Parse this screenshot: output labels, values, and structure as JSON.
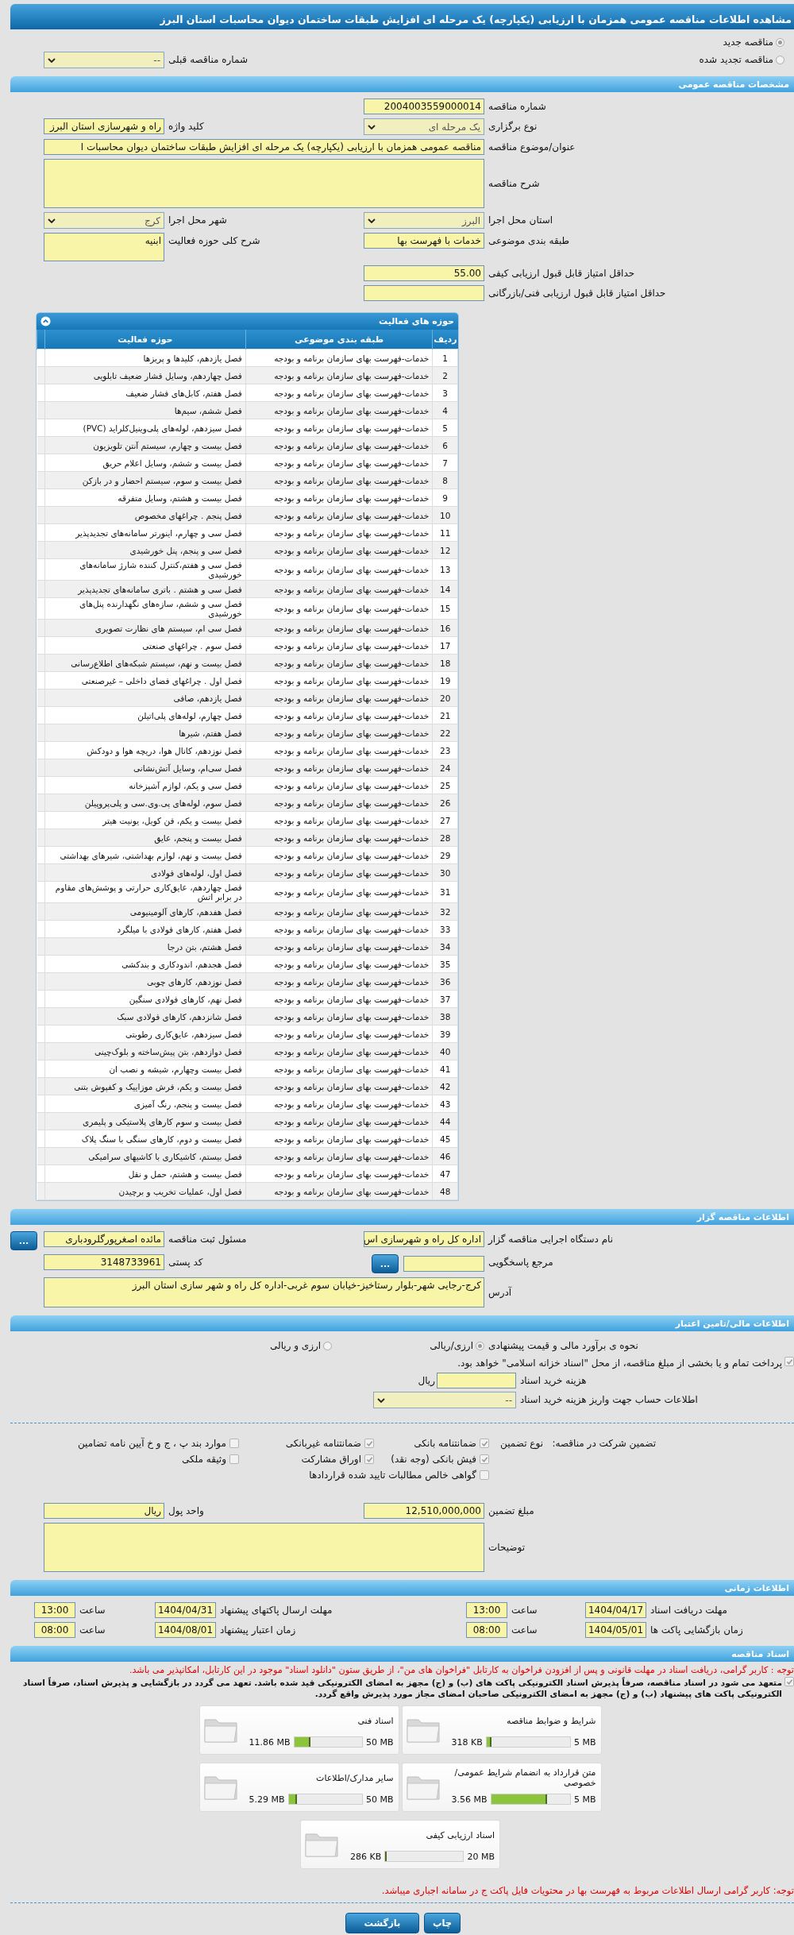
{
  "title": "مشاهده اطلاعات مناقصه عمومی همزمان با ارزیابی (یکپارچه) یک مرحله ای افزایش طبقات ساختمان دیوان محاسبات استان البرز",
  "tender_status": [
    {
      "label": "مناقصه جدید",
      "selected": true
    },
    {
      "label": "مناقصه تجدید شده",
      "selected": false
    }
  ],
  "previous_tender": {
    "label": "شماره مناقصه قبلی",
    "value": "--"
  },
  "general": {
    "header": "مشخصات مناقصه عمومی",
    "rows": [
      [
        {
          "kind": "text",
          "label": "شماره مناقصه",
          "value": "2004003559000014"
        }
      ],
      [
        {
          "kind": "select",
          "label": "نوع برگزاری",
          "value": "یک مرحله ای"
        },
        {
          "kind": "text",
          "label": "کلید واژه",
          "value": "راه و شهرسازی استان البرز"
        }
      ],
      [
        {
          "kind": "title",
          "label": "عنوان/موضوع مناقصه",
          "value": "مناقصه عمومی همزمان با ارزیابی (یکپارچه) یک مرحله ای افزایش طبقات ساختمان دیوان محاسبات ا"
        }
      ],
      [
        {
          "kind": "memo",
          "label": "شرح مناقصه"
        }
      ],
      [
        {
          "kind": "select",
          "label": "استان محل اجرا",
          "value": "البرز"
        },
        {
          "kind": "select",
          "label": "شهر محل اجرا",
          "value": "کرج"
        }
      ],
      [
        {
          "kind": "text",
          "label": "طبقه بندی موضوعی",
          "value": "خدمات با فهرست بها"
        },
        {
          "kind": "area",
          "label": "شرح کلی حوزه فعالیت",
          "value": "ابنیه"
        }
      ],
      [
        {
          "kind": "text",
          "label": "حداقل امتیاز قابل قبول ارزیابی کیفی",
          "value": "55.00"
        }
      ],
      [
        {
          "kind": "text",
          "label": "حداقل امتیاز قابل قبول ارزیابی فنی/بازرگانی"
        }
      ]
    ]
  },
  "activities": {
    "header": "حوزه های فعالیت",
    "columns": [
      "ردیف",
      "طبقه بندی موضوعی",
      "حوزه فعالیت"
    ],
    "rows": [
      {
        "no": "1",
        "category": "خدمات-فهرست بهای سازمان برنامه و بودجه",
        "field": "فصل یازدهم، کلیدها و پریزها"
      },
      {
        "no": "2",
        "category": "خدمات-فهرست بهای سازمان برنامه و بودجه",
        "field": "فصل چهاردهم، وسایل فشار ضعیف تابلویی"
      },
      {
        "no": "3",
        "category": "خدمات-فهرست بهای سازمان برنامه و بودجه",
        "field": "فصل هفتم، کابل‌های فشار ضعیف"
      },
      {
        "no": "4",
        "category": "خدمات-فهرست بهای سازمان برنامه و بودجه",
        "field": "فصل ششم، سیم‌ها"
      },
      {
        "no": "5",
        "category": "خدمات-فهرست بهای سازمان برنامه و بودجه",
        "field": "فصل سیزدهم، لوله‌های پلی‌وینیل‌کلراید (PVC)"
      },
      {
        "no": "6",
        "category": "خدمات-فهرست بهای سازمان برنامه و بودجه",
        "field": "فصل بیست و چهارم، سیستم آنتن تلویزیون"
      },
      {
        "no": "7",
        "category": "خدمات-فهرست بهای سازمان برنامه و بودجه",
        "field": "فصل بیست و ششم، وسایل اعلام حریق"
      },
      {
        "no": "8",
        "category": "خدمات-فهرست بهای سازمان برنامه و بودجه",
        "field": "فصل بیست و سوم، سیستم احضار و در بازکن"
      },
      {
        "no": "9",
        "category": "خدمات-فهرست بهای سازمان برنامه و بودجه",
        "field": "فصل بیست و هشتم، وسایل متفرقه"
      },
      {
        "no": "10",
        "category": "خدمات-فهرست بهای سازمان برنامه و بودجه",
        "field": "فصل پنجم . چراغهای مخصوص"
      },
      {
        "no": "11",
        "category": "خدمات-فهرست بهای سازمان برنامه و بودجه",
        "field": "فصل سی و چهارم، اینورتر سامانه‌های تجدیدپذیر"
      },
      {
        "no": "12",
        "category": "خدمات-فهرست بهای سازمان برنامه و بودجه",
        "field": "فصل سی و پنجم، پنل خورشیدی"
      },
      {
        "no": "13",
        "category": "خدمات-فهرست بهای سازمان برنامه و بودجه",
        "field": "فصل سی و هفتم،کنترل کننده شارژ سامانه‌های خورشیدی"
      },
      {
        "no": "14",
        "category": "خدمات-فهرست بهای سازمان برنامه و بودجه",
        "field": "فصل سی و هشتم . باتری سامانه‌های تجدیدپذیر"
      },
      {
        "no": "15",
        "category": "خدمات-فهرست بهای سازمان برنامه و بودجه",
        "field": "فصل سی و ششم، سازه‌های نگهدارنده پنل‌های خورشیدی"
      },
      {
        "no": "16",
        "category": "خدمات-فهرست بهای سازمان برنامه و بودجه",
        "field": "فصل سی ام، سیستم های نظارت تصویری"
      },
      {
        "no": "17",
        "category": "خدمات-فهرست بهای سازمان برنامه و بودجه",
        "field": "فصل سوم . چراغهای صنعتی"
      },
      {
        "no": "18",
        "category": "خدمات-فهرست بهای سازمان برنامه و بودجه",
        "field": "فصل بیست و نهم، سیستم شبکه‌های اطلاع‌رسانی"
      },
      {
        "no": "19",
        "category": "خدمات-فهرست بهای سازمان برنامه و بودجه",
        "field": "فصل اول . چراغهای فضای داخلی – غیرصنعتی"
      },
      {
        "no": "20",
        "category": "خدمات-فهرست بهای سازمان برنامه و بودجه",
        "field": "فصل یازدهم، صافی"
      },
      {
        "no": "21",
        "category": "خدمات-فهرست بهای سازمان برنامه و بودجه",
        "field": "فصل چهارم، لوله‌های پلی‌اتیلن"
      },
      {
        "no": "22",
        "category": "خدمات-فهرست بهای سازمان برنامه و بودجه",
        "field": "فصل هفتم، شیرها"
      },
      {
        "no": "23",
        "category": "خدمات-فهرست بهای سازمان برنامه و بودجه",
        "field": "فصل نوزدهم، کانال هوا، دریچه هوا و دودکش"
      },
      {
        "no": "24",
        "category": "خدمات-فهرست بهای سازمان برنامه و بودجه",
        "field": "فصل سی‌ام، وسایل آتش‌نشانی"
      },
      {
        "no": "25",
        "category": "خدمات-فهرست بهای سازمان برنامه و بودجه",
        "field": "فصل سی و یکم، لوازم آشپزخانه"
      },
      {
        "no": "26",
        "category": "خدمات-فهرست بهای سازمان برنامه و بودجه",
        "field": "فصل سوم، لوله‌های پی.وی.سی و پلی‌پروپیلن"
      },
      {
        "no": "27",
        "category": "خدمات-فهرست بهای سازمان برنامه و بودجه",
        "field": "فصل بیست و یکم، فن کویل، یونیت هیتر"
      },
      {
        "no": "28",
        "category": "خدمات-فهرست بهای سازمان برنامه و بودجه",
        "field": "فصل بیست و پنجم، عایق"
      },
      {
        "no": "29",
        "category": "خدمات-فهرست بهای سازمان برنامه و بودجه",
        "field": "فصل بیست و نهم، لوازم بهداشتی، شیرهای بهداشتی"
      },
      {
        "no": "30",
        "category": "خدمات-فهرست بهای سازمان برنامه و بودجه",
        "field": "فصل اول، لوله‌های فولادی"
      },
      {
        "no": "31",
        "category": "خدمات-فهرست بهای سازمان برنامه و بودجه",
        "field": "فصل چهاردهم، عایق‌کاری حرارتی و پوشش‌های مقاوم در برابر اتش"
      },
      {
        "no": "32",
        "category": "خدمات-فهرست بهای سازمان برنامه و بودجه",
        "field": "فصل هفدهم، کارهای آلومینیومی"
      },
      {
        "no": "33",
        "category": "خدمات-فهرست بهای سازمان برنامه و بودجه",
        "field": "فصل هفتم، کارهای فولادی با میلگرد"
      },
      {
        "no": "34",
        "category": "خدمات-فهرست بهای سازمان برنامه و بودجه",
        "field": "فصل هشتم، بتن درجا"
      },
      {
        "no": "35",
        "category": "خدمات-فهرست بهای سازمان برنامه و بودجه",
        "field": "فصل هجدهم، اندودکاری و بندکشی"
      },
      {
        "no": "36",
        "category": "خدمات-فهرست بهای سازمان برنامه و بودجه",
        "field": "فصل نوزدهم، کارهای چوبی"
      },
      {
        "no": "37",
        "category": "خدمات-فهرست بهای سازمان برنامه و بودجه",
        "field": "فصل نهم، کارهای فولادی سنگین"
      },
      {
        "no": "38",
        "category": "خدمات-فهرست بهای سازمان برنامه و بودجه",
        "field": "فصل شانزدهم، کارهای فولادی سبک"
      },
      {
        "no": "39",
        "category": "خدمات-فهرست بهای سازمان برنامه و بودجه",
        "field": "فصل سیزدهم، عایق‌کاری رطوبتی"
      },
      {
        "no": "40",
        "category": "خدمات-فهرست بهای سازمان برنامه و بودجه",
        "field": "فصل دوازدهم، بتن پیش‌ساخته و بلوک‌چینی"
      },
      {
        "no": "41",
        "category": "خدمات-فهرست بهای سازمان برنامه و بودجه",
        "field": "فصل بیست وچهارم، شیشه و نصب ان"
      },
      {
        "no": "42",
        "category": "خدمات-فهرست بهای سازمان برنامه و بودجه",
        "field": "فصل بیست و یکم، فرش موزاییک و کفپوش بتنی"
      },
      {
        "no": "43",
        "category": "خدمات-فهرست بهای سازمان برنامه و بودجه",
        "field": "فصل بیست و پنجم، رنگ آمیزی"
      },
      {
        "no": "44",
        "category": "خدمات-فهرست بهای سازمان برنامه و بودجه",
        "field": "فصل بیست و سوم کارهای پلاستیکی و پلیمری"
      },
      {
        "no": "45",
        "category": "خدمات-فهرست بهای سازمان برنامه و بودجه",
        "field": "فصل بیست و دوم، کارهای سنگی با سنگ پلاک"
      },
      {
        "no": "46",
        "category": "خدمات-فهرست بهای سازمان برنامه و بودجه",
        "field": "فصل بیستم، کاشیکاری با کاشیهای سرامیکی"
      },
      {
        "no": "47",
        "category": "خدمات-فهرست بهای سازمان برنامه و بودجه",
        "field": "فصل بیست و هشتم، حمل و نقل"
      },
      {
        "no": "48",
        "category": "خدمات-فهرست بهای سازمان برنامه و بودجه",
        "field": "فصل اول، عملیات تخریب و برچیدن"
      }
    ]
  },
  "organizer": {
    "header": "اطلاعات مناقصه گزار",
    "rows": [
      [
        {
          "kind": "text",
          "label": "نام دستگاه اجرایی مناقصه گزار",
          "value": "اداره کل راه و شهرسازی اس"
        },
        {
          "kind": "lookup",
          "label": "مسئول ثبت مناقصه",
          "value": "مائده اصغرپورگلرودباری",
          "button": "..."
        }
      ],
      [
        {
          "kind": "lookup",
          "label": "مرجع پاسخگویی",
          "button": "..."
        },
        {
          "kind": "text",
          "label": "کد پستی",
          "value": "3148733961"
        }
      ],
      [
        {
          "kind": "address",
          "label": "آدرس",
          "value": "کرج-رجایی شهر-بلوار رستاخیز-خیابان سوم غربی-اداره کل راه و شهر سازی استان البرز"
        }
      ]
    ]
  },
  "finance": {
    "header": "اطلاعات مالی/تامین اعتبار",
    "estimate": {
      "label": "نحوه ی برآورد مالی و قیمت پیشنهادی",
      "options": [
        {
          "label": "ارزی/ریالی",
          "selected": true
        },
        {
          "label": "ارزی و ریالی",
          "selected": false
        }
      ]
    },
    "treasury": {
      "label": "پرداخت تمام و یا بخشی از مبلغ مناقصه، از محل \"اسناد خزانه اسلامی\" خواهد بود.",
      "checked": true
    },
    "purchase_fee": {
      "label": "هزینه خرید اسناد",
      "unit": "ریال"
    },
    "account": {
      "label": "اطلاعات حساب جهت واریز هزینه خرید اسناد",
      "value": "--"
    },
    "guarantee": {
      "label": "تضمین شرکت در مناقصه:",
      "type_label": "نوع تضمین",
      "options": [
        {
          "label": "ضمانتنامه بانکی",
          "checked": true
        },
        {
          "label": "ضمانتنامه غیربانکی",
          "checked": true
        },
        {
          "label": "موارد بند پ ، ج و خ آیین نامه تضامین",
          "checked": false
        },
        {
          "label": "فیش بانکی (وجه نقد)",
          "checked": true
        },
        {
          "label": "اوراق مشارکت",
          "checked": true
        },
        {
          "label": "وثیقه ملکی",
          "checked": false
        },
        {
          "label": "گواهی خالص مطالبات تایید شده قراردادها",
          "checked": false
        }
      ]
    },
    "rows": [
      [
        {
          "kind": "text",
          "label": "مبلغ تضمین",
          "value": "12,510,000,000"
        },
        {
          "kind": "text",
          "label": "واحد پول",
          "value": "ریال"
        }
      ],
      [
        {
          "kind": "memo",
          "label": "توضیحات"
        }
      ]
    ]
  },
  "schedule": {
    "header": "اطلاعات زمانی",
    "items": [
      {
        "label": "مهلت دریافت اسناد",
        "date": "1404/04/17",
        "time_label": "ساعت",
        "time": "13:00"
      },
      {
        "label": "مهلت ارسال پاکتهای پیشنهاد",
        "date": "1404/04/31",
        "time_label": "ساعت",
        "time": "13:00"
      },
      {
        "label": "زمان بازگشایی پاکت ها",
        "date": "1404/05/01",
        "time_label": "ساعت",
        "time": "08:00"
      },
      {
        "label": "زمان اعتبار پیشنهاد",
        "date": "1404/08/01",
        "time_label": "ساعت",
        "time": "08:00"
      }
    ]
  },
  "documents": {
    "header": "اسناد مناقصه",
    "notice": "توجه : کاربر گرامی، دریافت اسناد در مهلت قانونی و پس از افزودن فراخوان به کارتابل \"فراخوان های من\"، از طریق ستون \"دانلود اسناد\" موجود در این کارتابل، امکانپذیر می باشد.",
    "pledge": {
      "text": "متعهد می شود در اسناد مناقصه، صرفاً پذیرش اسناد الکترونیکی پاکت های (ب) و (ج) مجهز به امضای الکترونیکی قید شده باشد. تعهد می گردد در بازگشایی و پذیرش اسناد، صرفاً اسناد الکترونیکی پاکت های پیشنهاد (ب) و (ج) مجهز به امضای الکترونیکی صاحبان امضای مجاز مورد پذیرش واقع گردد.",
      "checked": true
    },
    "files": [
      {
        "name": "شرایط و ضوابط مناقصه",
        "size": "318 KB",
        "max": "5 MB",
        "level": 0.06
      },
      {
        "name": "اسناد فنی",
        "size": "11.86 MB",
        "max": "50 MB",
        "level": 0.24
      },
      {
        "name": "متن قرارداد به انضمام شرایط عمومی/خصوصی",
        "size": "3.56 MB",
        "max": "5 MB",
        "level": 0.71
      },
      {
        "name": "سایر مدارک/اطلاعات",
        "size": "5.29 MB",
        "max": "50 MB",
        "level": 0.11
      },
      {
        "name": "اسناد ارزیابی کیفی",
        "size": "286 KB",
        "max": "20 MB",
        "level": 0.02
      }
    ],
    "footer_note": "توجه: کاربر گرامی ارسال اطلاعات مربوط به فهرست بها در محتویات فایل پاکت ج در سامانه اجباری میباشد."
  },
  "buttons": [
    "چاپ",
    "بازگشت"
  ]
}
